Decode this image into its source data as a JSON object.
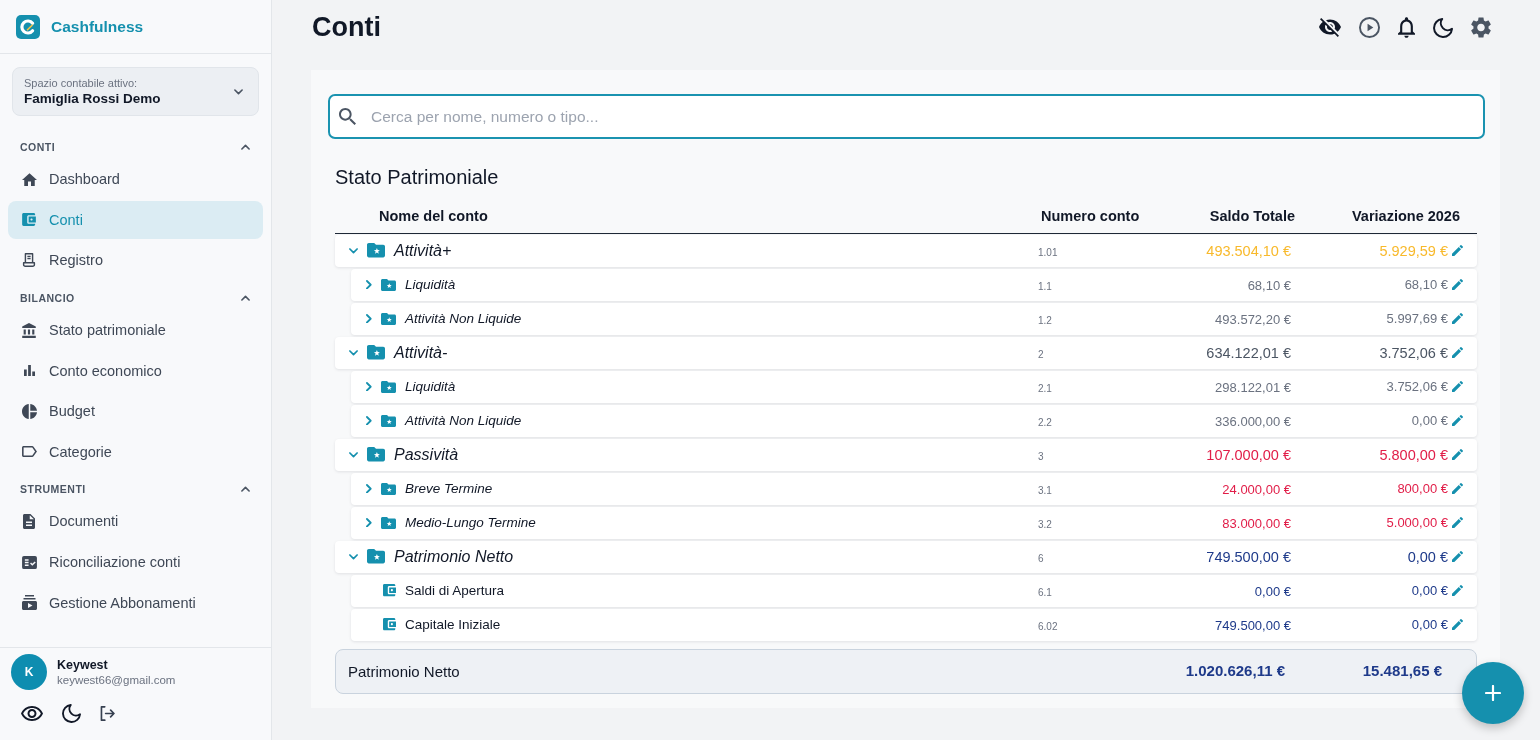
{
  "app": {
    "name": "Cashfulness"
  },
  "workspace": {
    "label": "Spazio contabile attivo:",
    "value": "Famiglia Rossi Demo"
  },
  "sidebar": {
    "sections": [
      {
        "title": "CONTI",
        "expanded": true,
        "items": [
          {
            "label": "Dashboard",
            "selected": false
          },
          {
            "label": "Conti",
            "selected": true
          },
          {
            "label": "Registro",
            "selected": false
          }
        ]
      },
      {
        "title": "BILANCIO",
        "expanded": true,
        "items": [
          {
            "label": "Stato patrimoniale",
            "selected": false
          },
          {
            "label": "Conto economico",
            "selected": false
          },
          {
            "label": "Budget",
            "selected": false
          },
          {
            "label": "Categorie",
            "selected": false
          }
        ]
      },
      {
        "title": "STRUMENTI",
        "expanded": true,
        "items": [
          {
            "label": "Documenti",
            "selected": false
          },
          {
            "label": "Riconciliazione conti",
            "selected": false
          },
          {
            "label": "Gestione Abbonamenti",
            "selected": false
          }
        ]
      }
    ]
  },
  "user": {
    "initial": "K",
    "name": "Keywest",
    "email": "keywest66@gmail.com"
  },
  "page": {
    "title": "Conti"
  },
  "search": {
    "placeholder": "Cerca per nome, numero o tipo..."
  },
  "report": {
    "title": "Stato Patrimoniale",
    "columns": [
      "Nome del conto",
      "Numero conto",
      "Saldo Totale",
      "Variazione 2026"
    ],
    "rows": [
      {
        "kind": "group",
        "name": "Attività+",
        "number": "1.01",
        "balance": "493.504,10 €",
        "change": "5.929,59 €",
        "color": "#f8b92b",
        "expanded": true,
        "children": [
          {
            "kind": "group",
            "name": "Liquidità",
            "number": "1.1",
            "balance": "68,10 €",
            "change": "68,10 €",
            "color": "#6b7280",
            "expanded": false
          },
          {
            "kind": "group",
            "name": "Attività Non Liquide",
            "number": "1.2",
            "balance": "493.572,20 €",
            "change": "5.997,69 €",
            "color": "#6b7280",
            "expanded": false
          }
        ]
      },
      {
        "kind": "group",
        "name": "Attività-",
        "number": "2",
        "balance": "634.122,01 €",
        "change": "3.752,06 €",
        "color": "#4b5563",
        "expanded": true,
        "children": [
          {
            "kind": "group",
            "name": "Liquidità",
            "number": "2.1",
            "balance": "298.122,01 €",
            "change": "3.752,06 €",
            "color": "#6b7280",
            "expanded": false
          },
          {
            "kind": "group",
            "name": "Attività Non Liquide",
            "number": "2.2",
            "balance": "336.000,00 €",
            "change": "0,00 €",
            "color": "#6b7280",
            "expanded": false
          }
        ]
      },
      {
        "kind": "group",
        "name": "Passività",
        "number": "3",
        "balance": "107.000,00 €",
        "change": "5.800,00 €",
        "color": "#e11d48",
        "expanded": true,
        "children": [
          {
            "kind": "group",
            "name": "Breve Termine",
            "number": "3.1",
            "balance": "24.000,00 €",
            "change": "800,00 €",
            "color": "#e11d48",
            "expanded": false
          },
          {
            "kind": "group",
            "name": "Medio-Lungo Termine",
            "number": "3.2",
            "balance": "83.000,00 €",
            "change": "5.000,00 €",
            "color": "#e11d48",
            "expanded": false
          }
        ]
      },
      {
        "kind": "group",
        "name": "Patrimonio Netto",
        "number": "6",
        "balance": "749.500,00 €",
        "change": "0,00 €",
        "color": "#1e3a8a",
        "expanded": true,
        "children": [
          {
            "kind": "account",
            "name": "Saldi di Apertura",
            "number": "6.1",
            "balance": "0,00 €",
            "change": "0,00 €",
            "color": "#1e3a8a"
          },
          {
            "kind": "account",
            "name": "Capitale Iniziale",
            "number": "6.02",
            "balance": "749.500,00 €",
            "change": "0,00 €",
            "color": "#1e3a8a"
          }
        ]
      }
    ]
  },
  "total": {
    "label": "Patrimonio Netto",
    "balance": "1.020.626,11 €",
    "change": "15.481,65 €"
  }
}
